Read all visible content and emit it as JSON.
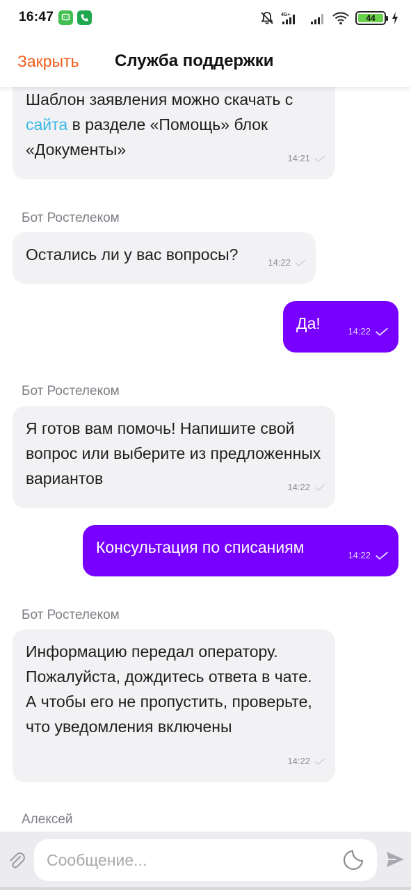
{
  "status_bar": {
    "time": "16:47",
    "battery_level": "44",
    "network_type": "4G+",
    "icons": [
      "messenger-icon",
      "phone-call-icon",
      "mute-icon",
      "signal-icon",
      "wifi-icon",
      "battery-icon",
      "charging-icon"
    ]
  },
  "header": {
    "close_label": "Закрыть",
    "title": "Служба поддержки"
  },
  "messages": [
    {
      "type": "bot",
      "text_before": "Шаблон заявления можно скачать с ",
      "link_text": "сайта",
      "text_after": " в разделе «Помощь» блок «Документы»",
      "time": "14:21"
    },
    {
      "type": "bot",
      "sender": "Бот Ростелеком",
      "text": "Остались ли у вас вопросы?",
      "time": "14:22"
    },
    {
      "type": "user",
      "text": "Да!",
      "time": "14:22"
    },
    {
      "type": "bot",
      "sender": "Бот Ростелеком",
      "text": "Я готов вам помочь! Напишите свой вопрос или выберите из предложенных вариантов",
      "time": "14:22"
    },
    {
      "type": "user",
      "text": "Консультация по списаниям",
      "time": "14:22"
    },
    {
      "type": "bot",
      "sender": "Бот Ростелеком",
      "text": "Информацию передал оператору. Пожалуйста, дождитесь ответа в чате. А чтобы его не пропустить, проверьте, что уведомления включены",
      "time": "14:22"
    },
    {
      "type": "operator",
      "sender": "Алексей"
    }
  ],
  "input": {
    "placeholder": "Сообщение...",
    "value": ""
  },
  "colors": {
    "accent_orange": "#f25c19",
    "user_bubble": "#7700ff",
    "bot_bubble": "#f2f2f4",
    "link": "#37b7e5"
  }
}
